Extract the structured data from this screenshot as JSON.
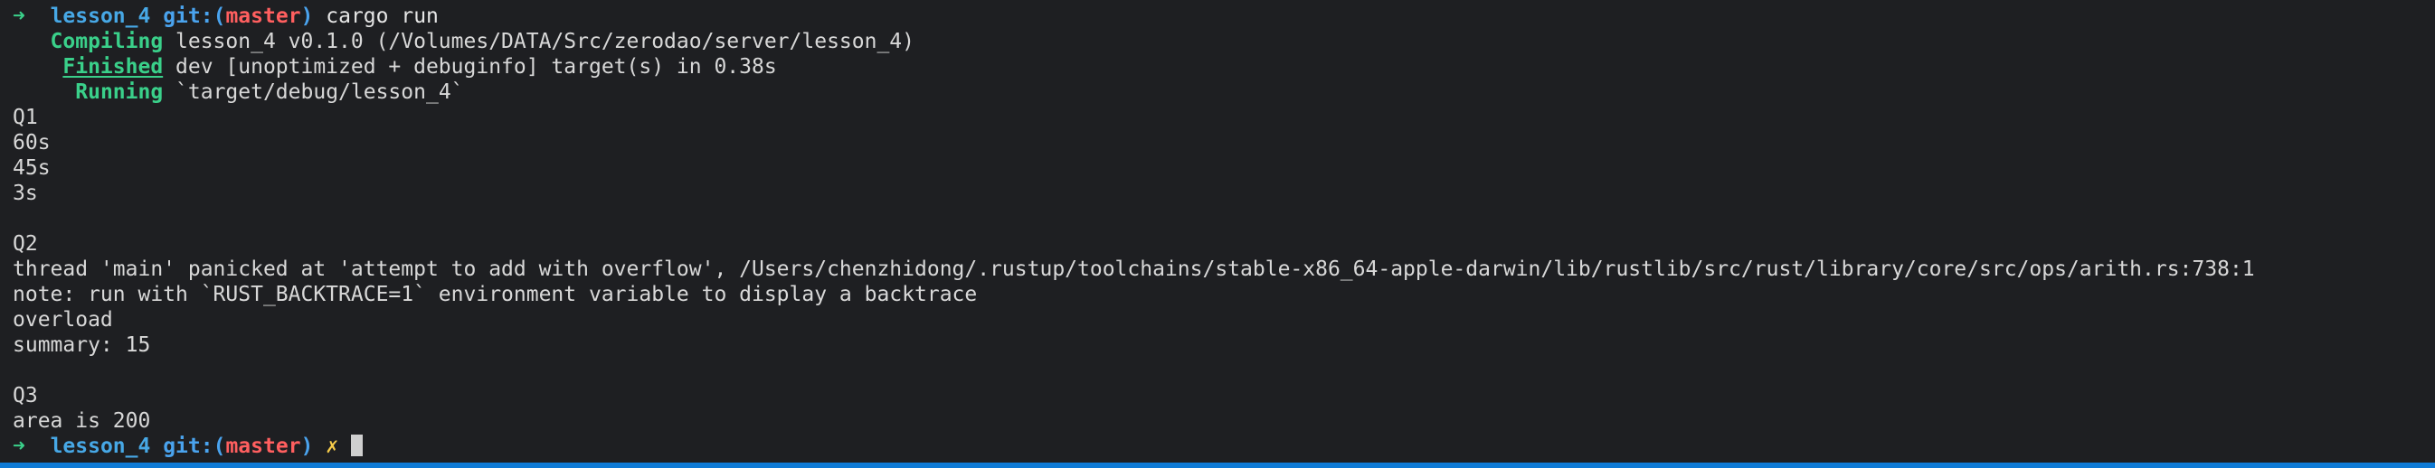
{
  "theme": {
    "background": "#1e1f22",
    "text": "#d8d8d8",
    "green": "#3ad08a",
    "blue": "#47a8e6",
    "red": "#ff5f5f",
    "yellow": "#f7cc4a",
    "status_bar": "#0f7bd6"
  },
  "prompt1": {
    "arrow": "➜",
    "dir": "lesson_4",
    "git_prefix": "git:(",
    "branch": "master",
    "git_suffix": ")",
    "command": "cargo run"
  },
  "build": {
    "compiling_label": "Compiling",
    "compiling_text": " lesson_4 v0.1.0 (/Volumes/DATA/Src/zerodao/server/lesson_4)",
    "finished_label": "Finished",
    "finished_text": " dev [unoptimized + debuginfo] target(s) in 0.38s",
    "running_label": "Running",
    "running_text": " `target/debug/lesson_4`"
  },
  "output_lines": [
    "Q1",
    "60s",
    "45s",
    "3s",
    "",
    "Q2",
    "thread 'main' panicked at 'attempt to add with overflow', /Users/chenzhidong/.rustup/toolchains/stable-x86_64-apple-darwin/lib/rustlib/src/rust/library/core/src/ops/arith.rs:738:1",
    "note: run with `RUST_BACKTRACE=1` environment variable to display a backtrace",
    "overload",
    "summary: 15",
    "",
    "Q3",
    "area is 200"
  ],
  "prompt2": {
    "arrow": "➜",
    "dir": "lesson_4",
    "git_prefix": "git:(",
    "branch": "master",
    "git_suffix": ")",
    "dirty": "✗"
  }
}
